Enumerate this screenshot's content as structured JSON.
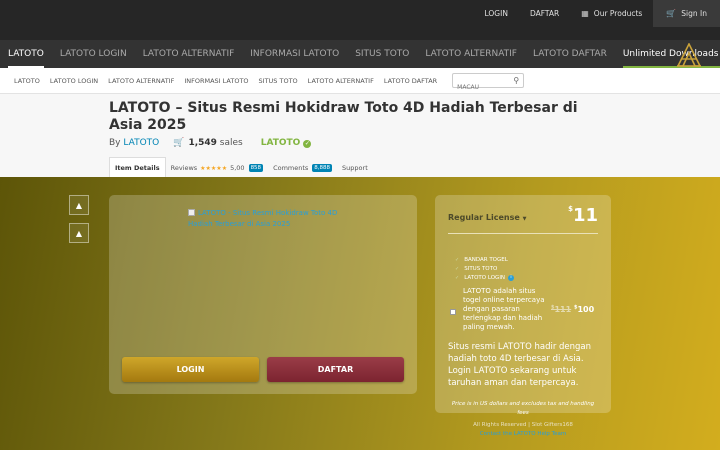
{
  "topbar": {
    "login": "LOGIN",
    "daftar": "DAFTAR",
    "products": "Our Products",
    "signin": "Sign In",
    "products_icon": "grid-icon",
    "signin_icon": "cart-icon"
  },
  "mainnav": {
    "items": [
      "LATOTO",
      "LATOTO LOGIN",
      "LATOTO ALTERNATIF",
      "INFORMASI LATOTO",
      "SITUS TOTO",
      "LATOTO ALTERNATIF",
      "LATOTO DAFTAR"
    ],
    "unlimited": "Unlimited Downloads",
    "logo_icon": "brand-logo-icon"
  },
  "subnav": {
    "items": [
      "LATOTO",
      "LATOTO LOGIN",
      "LATOTO ALTERNATIF",
      "INFORMASI LATOTO",
      "SITUS TOTO",
      "LATOTO ALTERNATIF",
      "LATOTO DAFTAR"
    ],
    "search_placeholder": "MACAU"
  },
  "header": {
    "title": "LATOTO – Situs Resmi Hokidraw Toto 4D Hadiah Terbesar di Asia 2025",
    "by": "By",
    "author_link": "LATOTO",
    "sales_count": "1,549",
    "sales_label": "sales",
    "author_badge": "LATOTO"
  },
  "tabs": {
    "item_details": "Item Details",
    "reviews": "Reviews",
    "rating": "5,00",
    "reviews_count": "858",
    "comments": "Comments",
    "comments_count": "8,888",
    "support": "Support"
  },
  "preview": {
    "image_alt": "LATOTO - Situs Resmi Hokidraw Toto 4D Hadiah Terbesar di Asia 2025",
    "login_button": "LOGIN",
    "daftar_button": "DAFTAR"
  },
  "purchase": {
    "license": "Regular License",
    "price_currency": "$",
    "price": "11",
    "features": [
      "BANDAR TOGEL",
      "SITUS TOTO",
      "LATOTO LOGIN"
    ],
    "support_text": "LATOTO adalah situs togel online terpercaya dengan pasaran terlengkap dan hadiah paling mewah.",
    "old_price": "111",
    "new_price": "100",
    "description": "Situs resmi LATOTO hadir dengan hadiah toto 4D terbesar di Asia. Login LATOTO sekarang untuk taruhan aman dan terpercaya.",
    "note": "Price is in US dollars and excludes tax and handling fees"
  },
  "footer": {
    "copyright": "All Rights Reserved | Slot Gifters168",
    "help": "Contact the LATOTO Help Team"
  },
  "colors": {
    "accent_green": "#82b541",
    "link_blue": "#0084b4",
    "hero_gold": "#d3ad1e"
  }
}
